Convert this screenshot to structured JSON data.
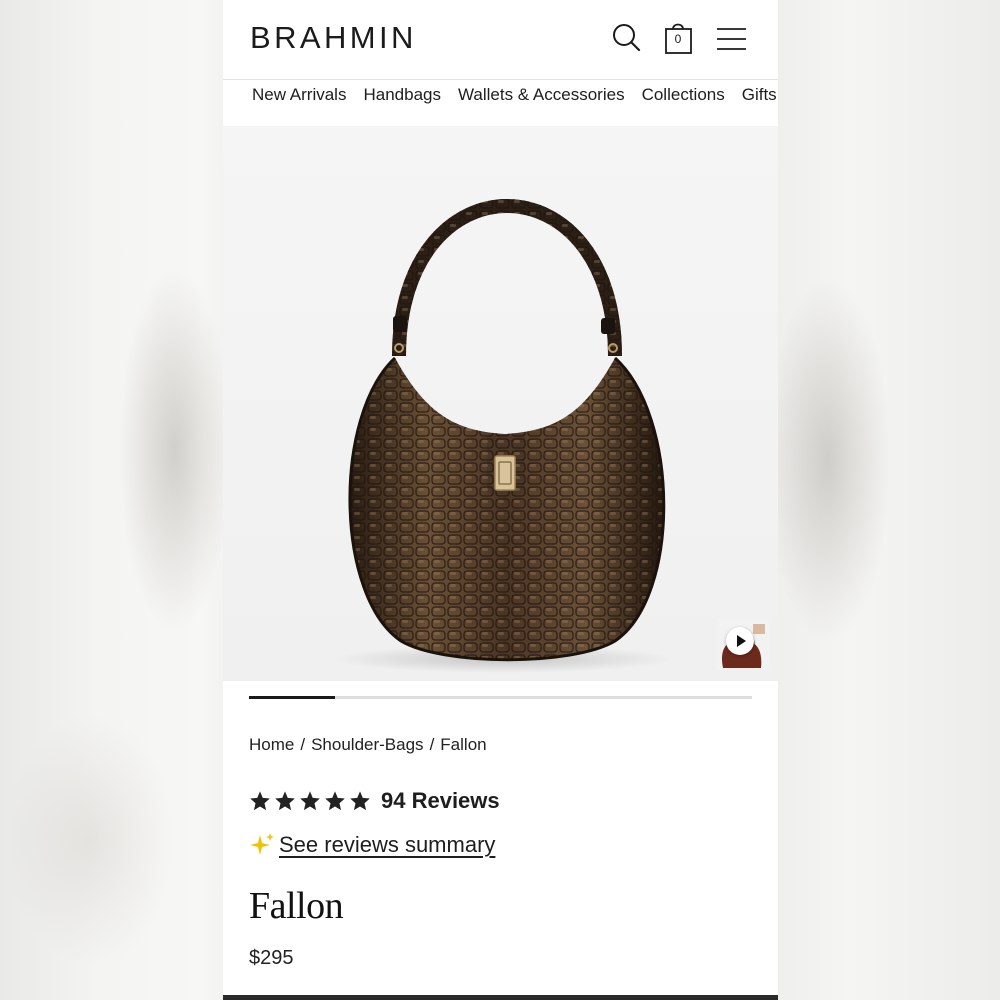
{
  "brand": {
    "logo_text": "BRAHMIN"
  },
  "header": {
    "icons": {
      "search": "search-icon",
      "bag": "shopping-bag-icon",
      "menu": "hamburger-menu-icon"
    },
    "bag_count": "0"
  },
  "nav": {
    "items": [
      {
        "label": "New Arrivals"
      },
      {
        "label": "Handbags"
      },
      {
        "label": "Wallets & Accessories"
      },
      {
        "label": "Collections"
      },
      {
        "label": "Gifts"
      }
    ]
  },
  "gallery": {
    "image_alt": "Fallon shoulder bag",
    "video_icon": "play-icon",
    "progress_fraction": 0.17
  },
  "breadcrumb": {
    "items": [
      {
        "label": "Home"
      },
      {
        "label": "Shoulder-Bags"
      },
      {
        "label": "Fallon"
      }
    ],
    "separator": "/"
  },
  "rating": {
    "stars": 5,
    "reviews_label": "94 Reviews"
  },
  "summary": {
    "icon": "sparkle-icon",
    "link_label": "See reviews summary"
  },
  "product": {
    "title": "Fallon",
    "price": "$295"
  },
  "colors": {
    "star": "#222222",
    "sparkle": "#f2c200",
    "accent": "#1a1a1a"
  }
}
